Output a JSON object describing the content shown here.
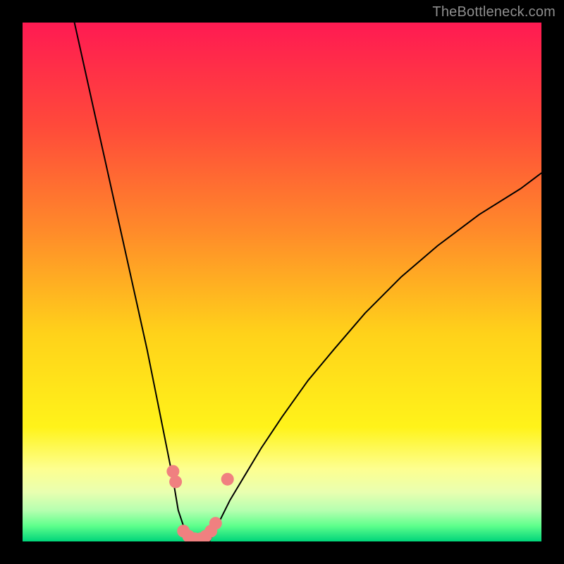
{
  "watermark": "TheBottleneck.com",
  "chart_data": {
    "type": "line",
    "title": "",
    "xlabel": "",
    "ylabel": "",
    "xlim": [
      0,
      100
    ],
    "ylim": [
      0,
      100
    ],
    "grid": false,
    "legend": false,
    "background": {
      "gradient_stops": [
        {
          "pos": 0.0,
          "color": "#ff1a52"
        },
        {
          "pos": 0.2,
          "color": "#ff4a3a"
        },
        {
          "pos": 0.4,
          "color": "#ff8a2a"
        },
        {
          "pos": 0.6,
          "color": "#ffd21a"
        },
        {
          "pos": 0.78,
          "color": "#fff31a"
        },
        {
          "pos": 0.86,
          "color": "#fdff90"
        },
        {
          "pos": 0.905,
          "color": "#e9ffb0"
        },
        {
          "pos": 0.94,
          "color": "#b6ffb0"
        },
        {
          "pos": 0.97,
          "color": "#5eff8c"
        },
        {
          "pos": 1.0,
          "color": "#00d47a"
        }
      ]
    },
    "series": [
      {
        "name": "left-branch",
        "color": "#000000",
        "width": 2,
        "x": [
          10,
          12,
          14,
          16,
          18,
          20,
          22,
          24,
          26,
          28,
          29,
          30,
          31,
          32
        ],
        "y": [
          100,
          91,
          82,
          73,
          64,
          55,
          46,
          37,
          27,
          17,
          12,
          6,
          3,
          0
        ]
      },
      {
        "name": "right-branch",
        "color": "#000000",
        "width": 2,
        "x": [
          36,
          38,
          40,
          43,
          46,
          50,
          55,
          60,
          66,
          73,
          80,
          88,
          96,
          100
        ],
        "y": [
          0,
          4,
          8,
          13,
          18,
          24,
          31,
          37,
          44,
          51,
          57,
          63,
          68,
          71
        ]
      },
      {
        "name": "valley-floor",
        "color": "#000000",
        "width": 2,
        "x": [
          32,
          33,
          34,
          35,
          36
        ],
        "y": [
          0,
          0,
          0,
          0,
          0
        ]
      }
    ],
    "markers": {
      "name": "highlight-dots",
      "color": "#f08080",
      "radius": 9,
      "points": [
        {
          "x": 29.0,
          "y": 13.5
        },
        {
          "x": 29.5,
          "y": 11.5
        },
        {
          "x": 31.0,
          "y": 2.0
        },
        {
          "x": 32.0,
          "y": 1.0
        },
        {
          "x": 33.2,
          "y": 0.5
        },
        {
          "x": 34.3,
          "y": 0.5
        },
        {
          "x": 35.3,
          "y": 1.0
        },
        {
          "x": 36.3,
          "y": 2.0
        },
        {
          "x": 37.2,
          "y": 3.5
        },
        {
          "x": 39.5,
          "y": 12.0
        }
      ]
    }
  }
}
